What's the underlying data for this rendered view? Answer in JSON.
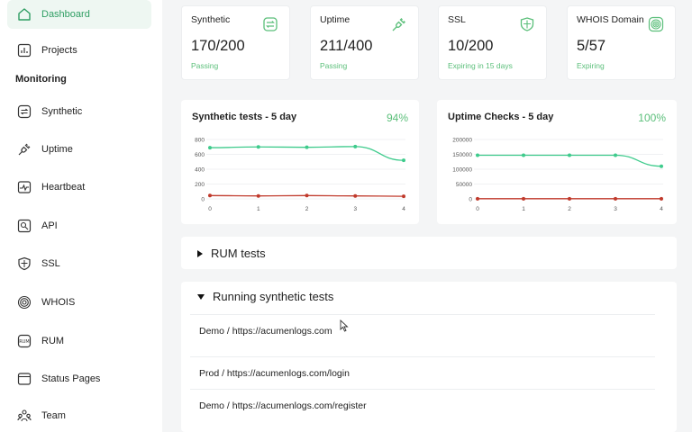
{
  "sidebar": {
    "items": [
      {
        "label": "Dashboard",
        "icon": "home-icon",
        "active": true
      },
      {
        "label": "Projects",
        "icon": "chart-icon"
      },
      {
        "label": "Synthetic",
        "icon": "synthetic-icon"
      },
      {
        "label": "Uptime",
        "icon": "plug-icon"
      },
      {
        "label": "Heartbeat",
        "icon": "heartbeat-icon"
      },
      {
        "label": "API",
        "icon": "api-icon"
      },
      {
        "label": "SSL",
        "icon": "shield-icon"
      },
      {
        "label": "WHOIS",
        "icon": "globe-icon"
      },
      {
        "label": "RUM",
        "icon": "rum-icon"
      },
      {
        "label": "Status Pages",
        "icon": "status-pages-icon"
      },
      {
        "label": "Team",
        "icon": "team-icon"
      }
    ],
    "section_label": "Monitoring"
  },
  "stats": [
    {
      "title": "Synthetic",
      "value": "170/200",
      "sub": "Passing",
      "icon": "synthetic-icon"
    },
    {
      "title": "Uptime",
      "value": "211/400",
      "sub": "Passing",
      "icon": "plug-icon"
    },
    {
      "title": "SSL",
      "value": "10/200",
      "sub": "Expiring in 15 days",
      "icon": "shield-icon"
    },
    {
      "title": "WHOIS Domain",
      "value": "5/57",
      "sub": "Expiring",
      "icon": "globe-icon"
    }
  ],
  "charts": [
    {
      "title": "Synthetic tests - 5 day",
      "percent": "94%"
    },
    {
      "title": "Uptime Checks - 5 day",
      "percent": "100%"
    }
  ],
  "chart_data": [
    {
      "type": "line",
      "title": "Synthetic tests - 5 day",
      "x": [
        0,
        1,
        2,
        3,
        4
      ],
      "ylim": [
        0,
        800
      ],
      "yticks": [
        0,
        200,
        400,
        600,
        800
      ],
      "series": [
        {
          "color": "#3ecb8c",
          "values": [
            690,
            700,
            695,
            705,
            520
          ]
        },
        {
          "color": "#c0392b",
          "values": [
            45,
            40,
            45,
            40,
            35
          ]
        }
      ]
    },
    {
      "type": "line",
      "title": "Uptime Checks - 5 day",
      "x": [
        0,
        1,
        2,
        3,
        4
      ],
      "ylim": [
        0,
        200000
      ],
      "yticks": [
        0,
        50000,
        100000,
        150000,
        200000
      ],
      "series": [
        {
          "color": "#3ecb8c",
          "values": [
            147000,
            147000,
            147000,
            147000,
            110000
          ]
        },
        {
          "color": "#c0392b",
          "values": [
            500,
            500,
            500,
            500,
            500
          ]
        }
      ]
    }
  ],
  "sections": {
    "rum_label": "RUM tests",
    "running_label": "Running synthetic tests",
    "tests": [
      "Demo / https://acumenlogs.com",
      "Prod / https://acumenlogs.com/login",
      "Demo / https://acumenlogs.com/register"
    ]
  },
  "colors": {
    "accent": "#5bbf7a",
    "line_green": "#3ecb8c",
    "line_red": "#c0392b"
  }
}
